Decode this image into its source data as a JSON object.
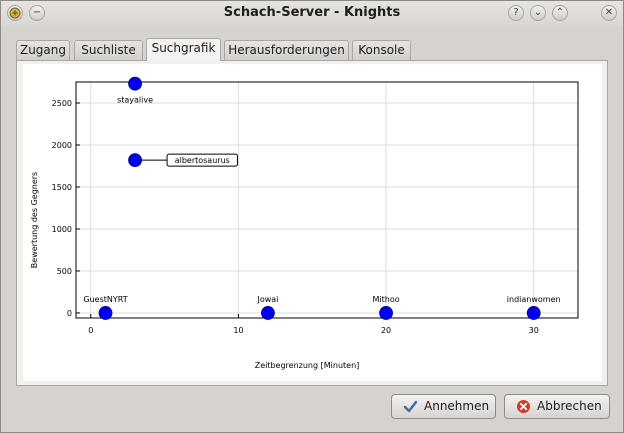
{
  "window": {
    "title": "Schach-Server - Knights"
  },
  "tabs": [
    {
      "label": "Zugang"
    },
    {
      "label": "Suchliste"
    },
    {
      "label": "Suchgrafik"
    },
    {
      "label": "Herausforderungen"
    },
    {
      "label": "Konsole"
    }
  ],
  "active_tab": "Suchgrafik",
  "chart_data": {
    "type": "scatter",
    "xlabel": "Zeitbegrenzung [Minuten]",
    "ylabel": "Bewertung des Gegners",
    "x_ticks": [
      0,
      10,
      20,
      30
    ],
    "y_ticks": [
      0,
      500,
      1000,
      1500,
      2000,
      2500
    ],
    "xlim": [
      -1,
      33
    ],
    "ylim": [
      -60,
      2750
    ],
    "grid": true,
    "marker_color": "#0000ee",
    "points": [
      {
        "label": "stayalive",
        "x": 3,
        "y": 2730,
        "label_style": "plain"
      },
      {
        "label": "albertosaurus",
        "x": 3,
        "y": 1820,
        "label_style": "callout"
      },
      {
        "label": "GuestNYRT",
        "x": 1,
        "y": 0,
        "label_style": "plain"
      },
      {
        "label": "Jowai",
        "x": 12,
        "y": 0,
        "label_style": "plain"
      },
      {
        "label": "Mithoo",
        "x": 20,
        "y": 0,
        "label_style": "plain"
      },
      {
        "label": "indianwomen",
        "x": 30,
        "y": 0,
        "label_style": "plain"
      }
    ]
  },
  "buttons": {
    "accept": "Annehmen",
    "cancel": "Abbrechen"
  }
}
